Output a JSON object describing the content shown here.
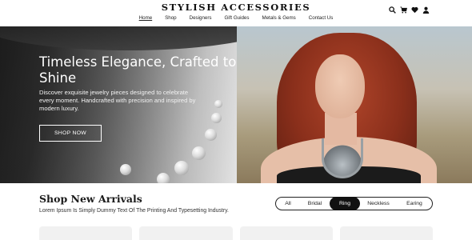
{
  "brand": "STYLISH ACCESSORIES",
  "nav": {
    "home": "Home",
    "shop": "Shop",
    "designers": "Designers",
    "gift_guides": "Gift Guides",
    "metals_gems": "Metals & Gems",
    "contact": "Contact Us"
  },
  "header_icons": [
    "search-icon",
    "cart-icon",
    "heart-icon",
    "user-icon"
  ],
  "hero": {
    "title": "Timeless Elegance, Crafted to Shine",
    "description": "Discover exquisite jewelry pieces designed to celebrate every moment. Handcrafted with precision and inspired by modern luxury.",
    "button": "SHOP NOW"
  },
  "arrivals": {
    "title": "Shop New Arrivals",
    "subtitle": "Lorem Ipsum Is Simply Dummy Text Of The Printing And Typesetting Industry.",
    "filters": {
      "all": "All",
      "bridal": "Bridal",
      "ring": "Ring",
      "neckless": "Neckless",
      "earing": "Earing"
    },
    "active_filter": "Ring"
  },
  "colors": {
    "accent": "#111111",
    "card_bg": "#f1f1f1"
  }
}
